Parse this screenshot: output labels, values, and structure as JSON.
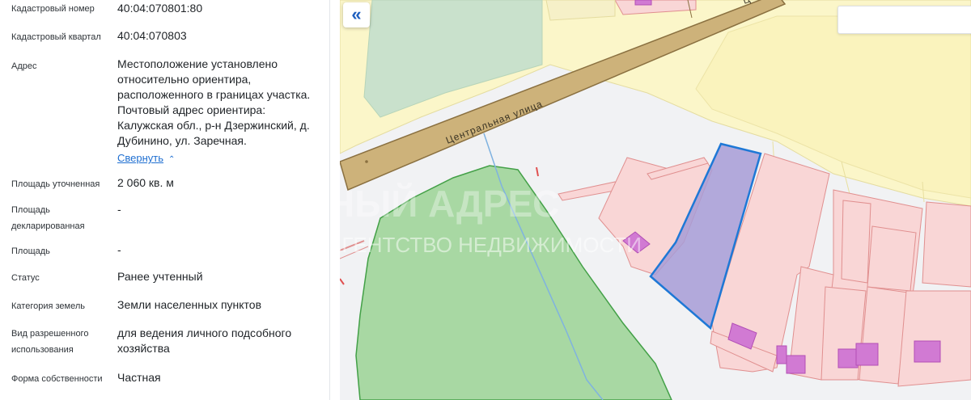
{
  "info": {
    "rows": [
      {
        "label": "Кадастровый номер",
        "value": "40:04:070801:80"
      },
      {
        "label": "Кадастровый квартал",
        "value": "40:04:070803"
      },
      {
        "label": "Адрес",
        "value_lines": [
          "Местоположение установлено",
          "относительно ориентира,",
          "расположенного в границах участка.",
          "Почтовый адрес ориентира:",
          "Калужская обл., р-н Дзержинский, д.",
          "Дубинино, ул. Заречная."
        ],
        "collapse_label": "Свернуть"
      },
      {
        "label": "Площадь уточненная",
        "value": "2 060 кв. м"
      },
      {
        "label_lines": [
          "Площадь",
          "декларированная"
        ],
        "value": "-"
      },
      {
        "label": "Площадь",
        "value": "-"
      },
      {
        "label": "Статус",
        "value": "Ранее учтенный"
      },
      {
        "label": "Категория земель",
        "value": "Земли населенных пунктов"
      },
      {
        "label_lines": [
          "Вид разрешенного",
          "использования"
        ],
        "value_lines": [
          "для ведения личного подсобного",
          "хозяйства"
        ]
      },
      {
        "label": "Форма собственности",
        "value": "Частная"
      }
    ]
  },
  "map": {
    "street_label": "Центральная улица",
    "street_label_top_fragment": "Ц",
    "watermark_line1": "НЫЙ АДРЕС",
    "watermark_line2": "АГЕНТСТВО НЕДВИЖИМОСТИ",
    "collapse_button_glyph": "«",
    "colors": {
      "background": "#f1f2f4",
      "settlement_fill": "#fbf6c9",
      "settlement_stroke": "#e4dca0",
      "road": "#cdb27a",
      "road_edge": "#8a7040",
      "forest_fill": "#a8d8a3",
      "forest_stroke": "#43a047",
      "field_fill": "#c9e1cc",
      "parcel_fill": "#f9d6d6",
      "parcel_stroke": "#e08f8f",
      "building_fill": "#d17ad3",
      "building_stroke": "#b24fb5",
      "selected_fill": "#a79cd6",
      "selected_stroke": "#1e78d6",
      "stream": "#7fb2e0"
    }
  }
}
